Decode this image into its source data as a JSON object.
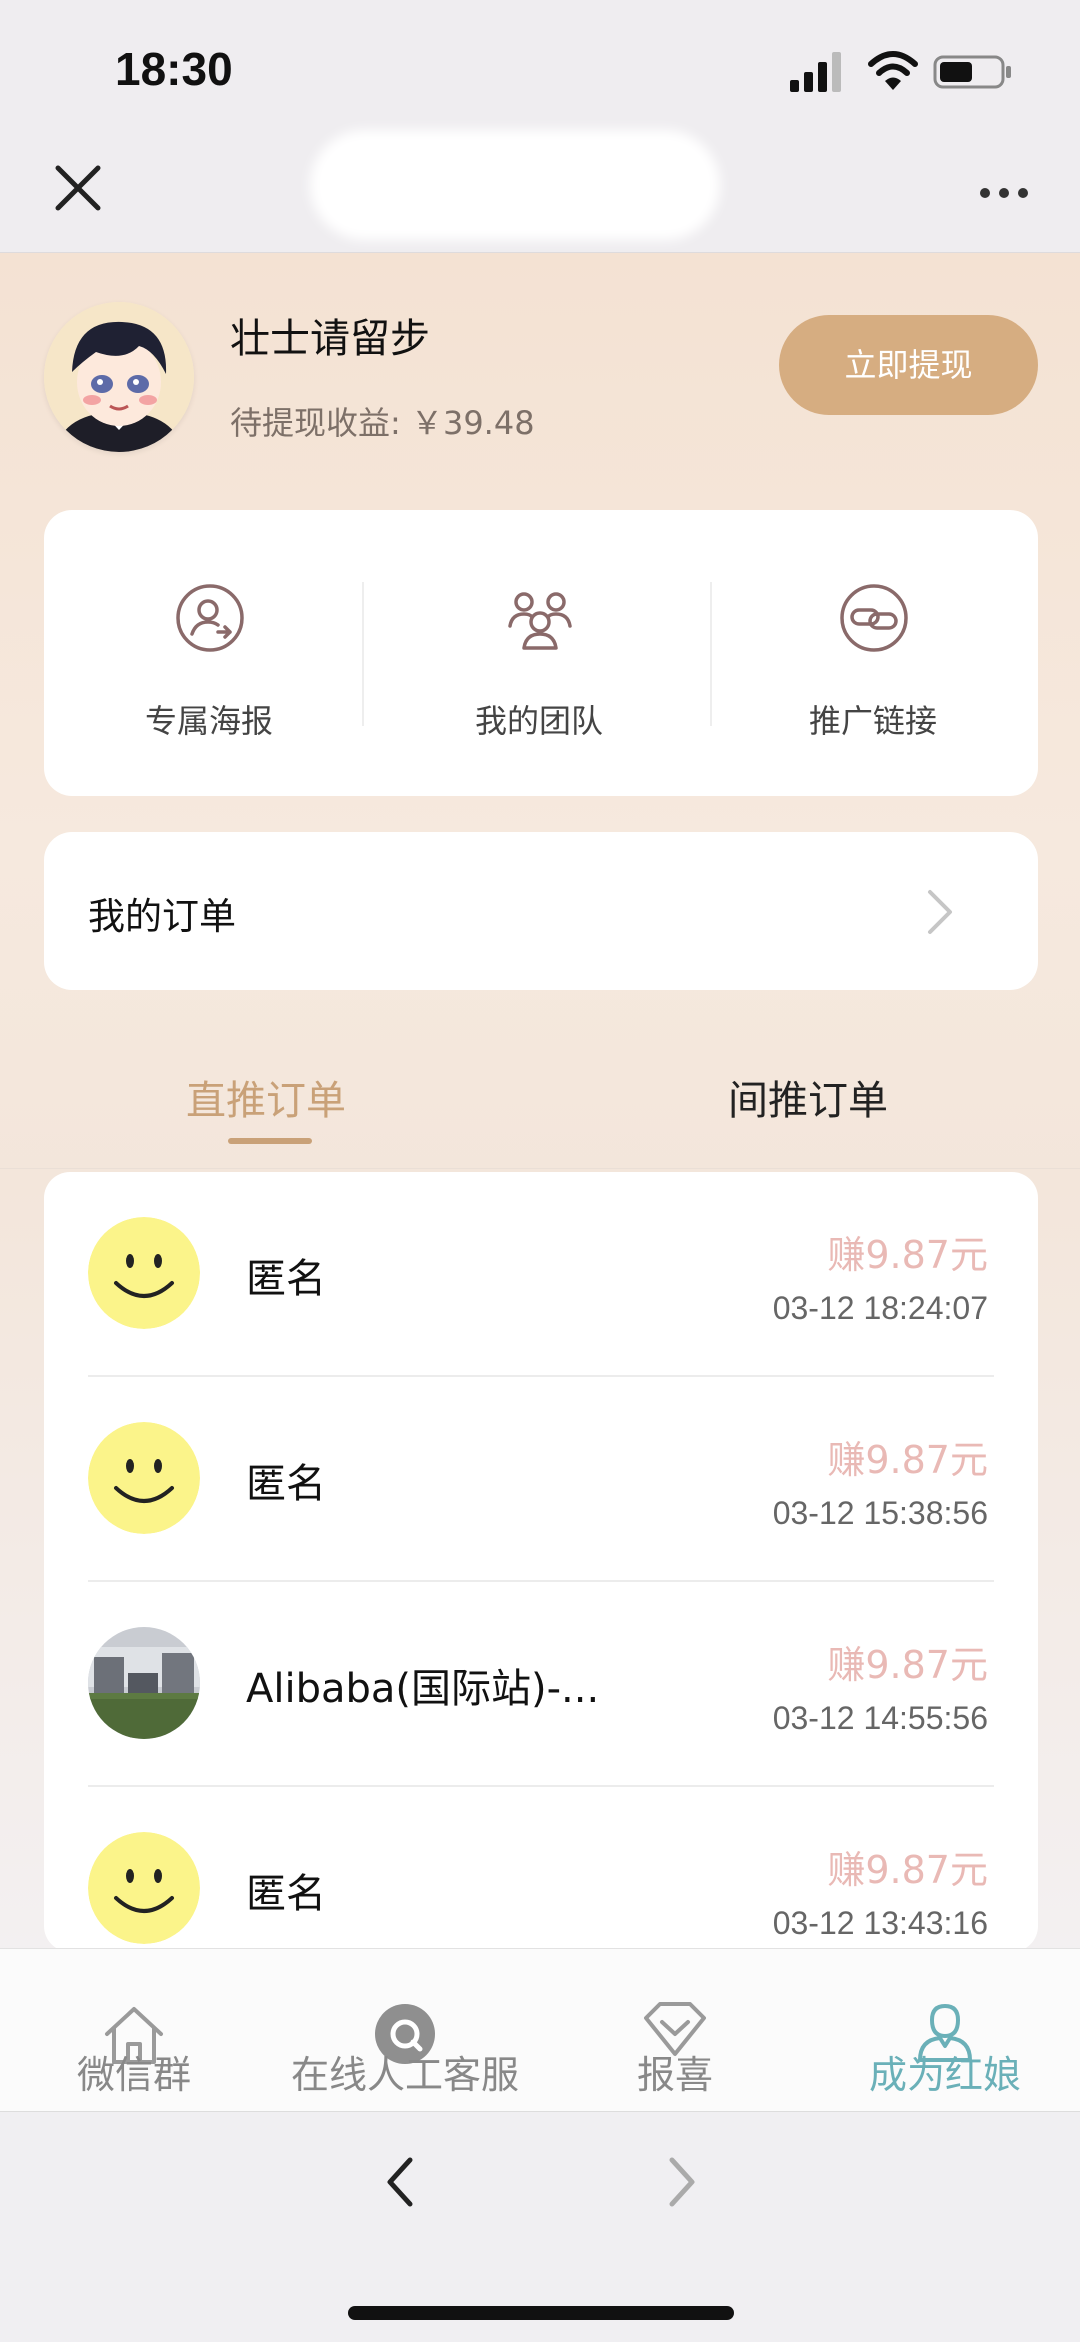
{
  "status_bar": {
    "time": "18:30"
  },
  "profile": {
    "name": "壮士请留步",
    "pending_label": "待提现收益: ￥39.48",
    "withdraw_button": "立即提现"
  },
  "quick_actions": [
    {
      "label": "专属海报",
      "icon": "user-share-icon"
    },
    {
      "label": "我的团队",
      "icon": "team-icon"
    },
    {
      "label": "推广链接",
      "icon": "link-icon"
    }
  ],
  "my_orders": {
    "label": "我的订单"
  },
  "tabs": [
    {
      "label": "直推订单",
      "active": true
    },
    {
      "label": "间推订单",
      "active": false
    }
  ],
  "orders": [
    {
      "name": "匿名",
      "earn": "赚9.87元",
      "time": "03-12 18:24:07",
      "avatar": "smiley-icon"
    },
    {
      "name": "匿名",
      "earn": "赚9.87元",
      "time": "03-12 15:38:56",
      "avatar": "smiley-icon"
    },
    {
      "name": "Alibaba(国际站)-...",
      "earn": "赚9.87元",
      "time": "03-12 14:55:56",
      "avatar": "building-photo"
    },
    {
      "name": "匿名",
      "earn": "赚9.87元",
      "time": "03-12 13:43:16",
      "avatar": "smiley-icon"
    }
  ],
  "bottom_tabs": [
    {
      "label": "微信群",
      "icon": "home-icon",
      "active": false
    },
    {
      "label": "在线人工客服",
      "icon": "chat-icon",
      "active": false
    },
    {
      "label": "报喜",
      "icon": "diamond-icon",
      "active": false
    },
    {
      "label": "成为红娘",
      "icon": "person-icon",
      "active": true
    }
  ],
  "colors": {
    "accent_gold": "#d6ad81",
    "tab_active": "#c9a178",
    "earn_pink": "#e9b9b5",
    "bottom_active": "#6ab0b8"
  }
}
